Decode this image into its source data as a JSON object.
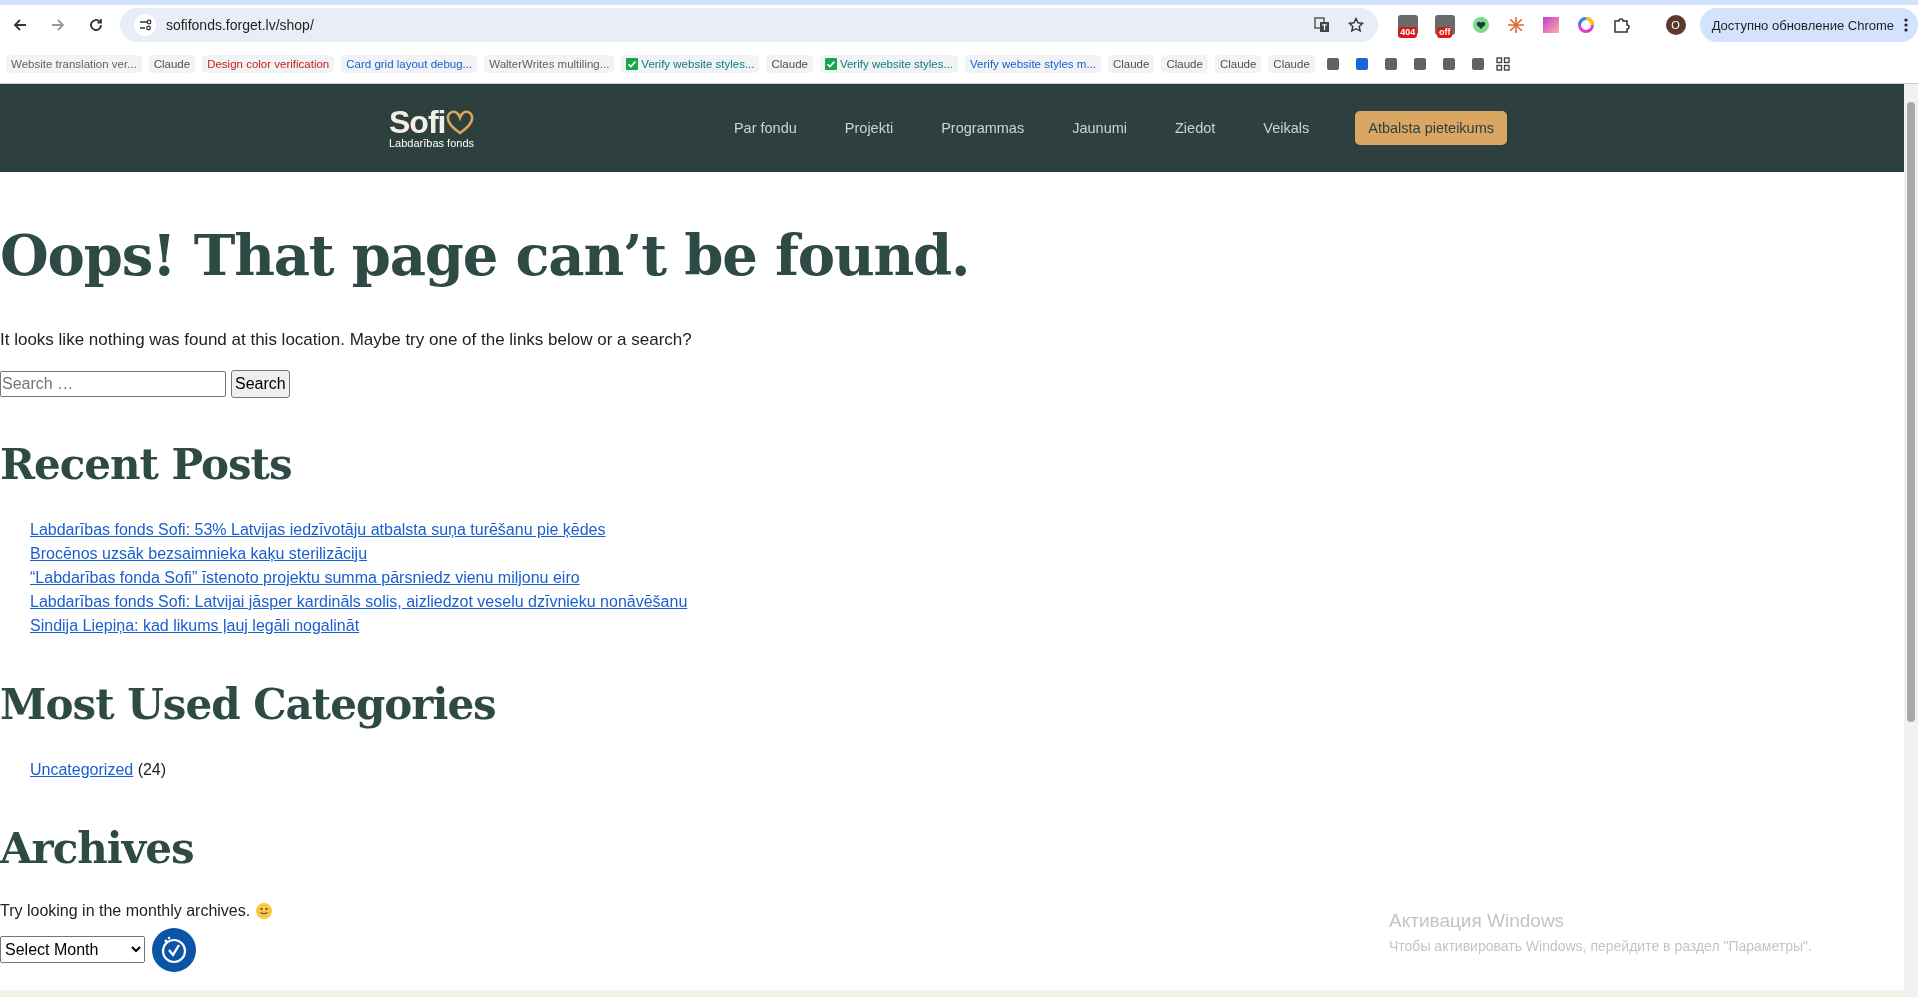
{
  "browser": {
    "address": "sofifonds.forget.lv/shop/",
    "extensions": [
      {
        "kind": "badge",
        "badge": "404"
      },
      {
        "kind": "badge",
        "badge": "off"
      },
      {
        "kind": "heart"
      },
      {
        "kind": "burst"
      },
      {
        "kind": "gradient"
      },
      {
        "kind": "ring"
      },
      {
        "kind": "puzzle"
      }
    ],
    "profile": "O",
    "update_button": "Доступно обновление Chrome"
  },
  "bookmarks": [
    {
      "label": "Website translation ver...",
      "color": "#5f6368",
      "verified": false
    },
    {
      "label": "Claude",
      "color": "#5f4b3a",
      "verified": false
    },
    {
      "label": "Design color verification",
      "color": "#c5221f",
      "verified": false
    },
    {
      "label": "Card grid layout debug...",
      "color": "#1a5fd0",
      "verified": false
    },
    {
      "label": "WalterWrites multiling...",
      "color": "#5f6368",
      "verified": false
    },
    {
      "label": "Verify website styles...",
      "color": "#0b7d7d",
      "verified": true
    },
    {
      "label": "Claude",
      "color": "#5f4b3a",
      "verified": false
    },
    {
      "label": "Verify website styles...",
      "color": "#0b7d7d",
      "verified": true
    },
    {
      "label": "Verify website styles m...",
      "color": "#1a5fd0",
      "verified": false
    },
    {
      "label": "Claude",
      "color": "#5f4b3a",
      "verified": false
    },
    {
      "label": "Claude",
      "color": "#5f4b3a",
      "verified": false
    },
    {
      "label": "Claude",
      "color": "#5f4b3a",
      "verified": false
    },
    {
      "label": "Claude",
      "color": "#5f4b3a",
      "verified": false
    }
  ],
  "favicon_bookmarks": [
    {
      "color": "#5f6368"
    },
    {
      "color": "#1a66d9"
    },
    {
      "color": "#5f6368"
    },
    {
      "color": "#5f6368"
    },
    {
      "color": "#5f6368"
    },
    {
      "color": "#5f6368"
    }
  ],
  "site_header": {
    "logo": {
      "name": "Sofi",
      "tagline": "Labdarības fonds"
    },
    "nav": [
      "Par fondu",
      "Projekti",
      "Programmas",
      "Jaunumi",
      "Ziedot",
      "Veikals"
    ],
    "cta": "Atbalsta pieteikums"
  },
  "page": {
    "title": "Oops! That page can’t be found.",
    "intro": "It looks like nothing was found at this location. Maybe try one of the links below or a search?",
    "search": {
      "placeholder": "Search …",
      "button": "Search"
    },
    "recent_posts": {
      "heading": "Recent Posts",
      "links": [
        "Labdarības fonds Sofi: 53% Latvijas iedzīvotāju atbalsta suņa turēšanu pie ķēdes",
        "Brocēnos uzsāk bezsaimnieka kaķu sterilizāciju",
        "“Labdarības fonda Sofi” īstenoto projektu summa pārsniedz vienu miljonu eiro",
        "Labdarības fonds Sofi: Latvijai jāsper kardināls solis, aizliedzot veselu dzīvnieku nonāvēšanu",
        "Sindija Liepiņa: kad likums ļauj legāli nogalināt"
      ]
    },
    "categories": {
      "heading": "Most Used Categories",
      "items": [
        {
          "label": "Uncategorized",
          "count": "(24)"
        }
      ]
    },
    "archives": {
      "heading": "Archives",
      "text": "Try looking in the monthly archives.",
      "select": "Select Month"
    }
  },
  "os_notice": {
    "title": "Активация Windows",
    "text": "Чтобы активировать Windows, перейдите в раздел \"Параметры\"."
  }
}
